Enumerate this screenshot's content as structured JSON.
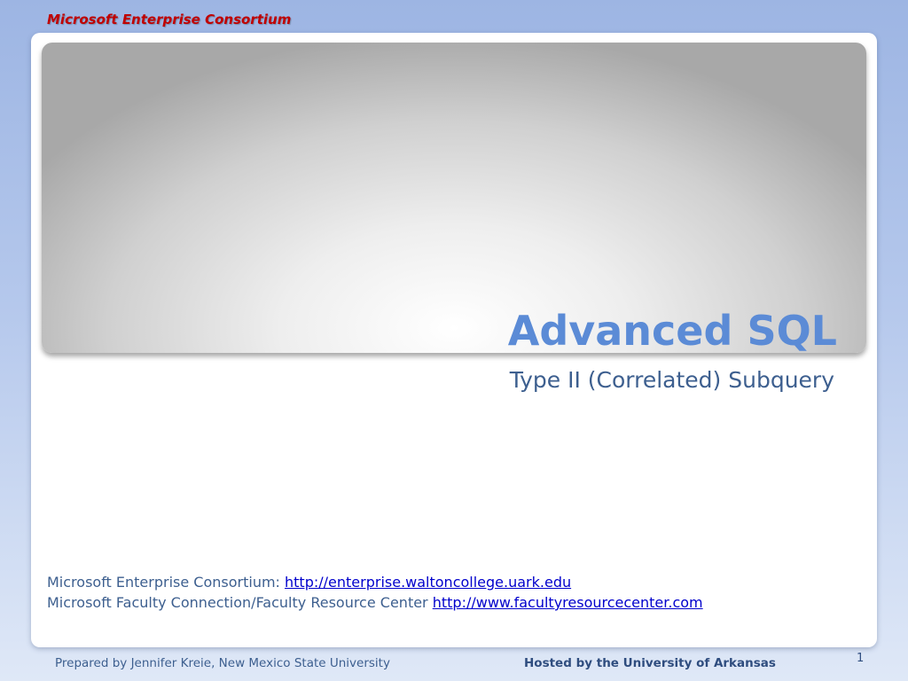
{
  "header": {
    "consortium_label": "Microsoft Enterprise Consortium"
  },
  "slide": {
    "title": "Advanced SQL",
    "subtitle": "Type II (Correlated) Subquery",
    "links": [
      {
        "prefix": "Microsoft Enterprise Consortium: ",
        "url_text": "http://enterprise.waltoncollege.uark.edu"
      },
      {
        "prefix": "Microsoft Faculty Connection/Faculty Resource Center ",
        "url_text": "http://www.facultyresourcecenter.com"
      }
    ]
  },
  "footer": {
    "prepared_by": "Prepared by Jennifer Kreie, New Mexico State University",
    "hosted_by": "Hosted by the University of Arkansas",
    "slide_number": "1"
  },
  "colors": {
    "header_red": "#c00000",
    "title_blue": "#5b8bd6",
    "text_blue": "#3d5f8f",
    "link_blue": "#0000cc"
  }
}
